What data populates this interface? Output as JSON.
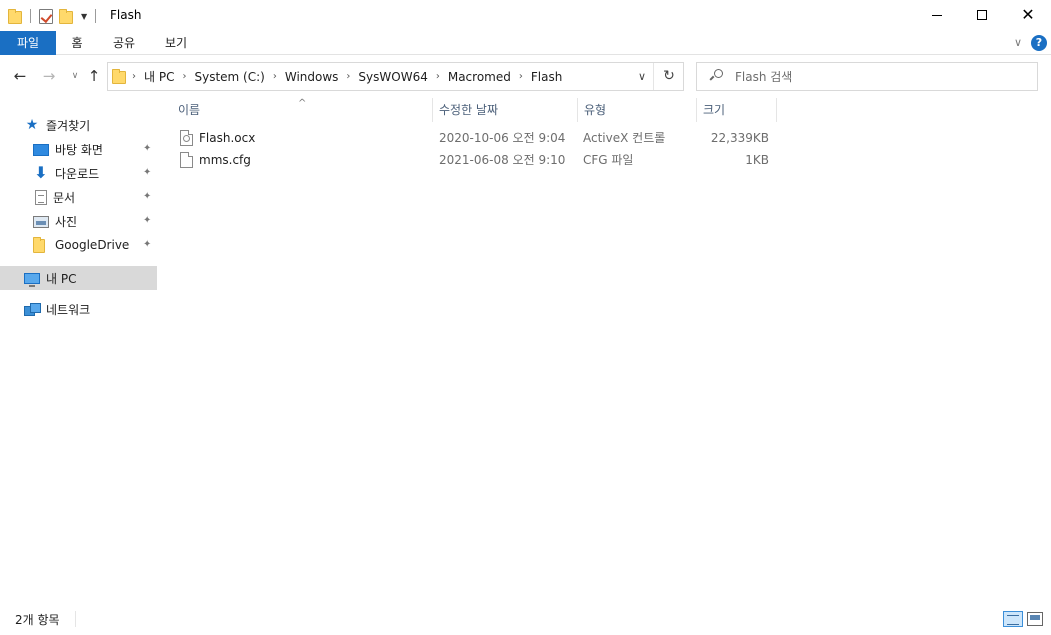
{
  "window": {
    "title": "Flash",
    "minimize_glyph": "",
    "close_glyph": "✕"
  },
  "ribbon": {
    "tabs": [
      {
        "label": "파일"
      },
      {
        "label": "홈"
      },
      {
        "label": "공유"
      },
      {
        "label": "보기"
      }
    ],
    "expand_glyph": "∨",
    "help_glyph": "?"
  },
  "nav": {
    "back_glyph": "←",
    "forward_glyph": "→",
    "recent_glyph": "∨",
    "up_glyph": "↑",
    "breadcrumb": [
      "내 PC",
      "System (C:)",
      "Windows",
      "SysWOW64",
      "Macromed",
      "Flash"
    ],
    "crumb_sep": "›",
    "dropdown_glyph": "∨",
    "refresh_glyph": "↻",
    "search_placeholder": "Flash 검색"
  },
  "sidebar": {
    "quick_access": {
      "label": "즐겨찾기",
      "icon": "star-icon"
    },
    "pinned": [
      {
        "label": "바탕 화면",
        "icon": "desktop-icon"
      },
      {
        "label": "다운로드",
        "icon": "download-icon"
      },
      {
        "label": "문서",
        "icon": "documents-icon"
      },
      {
        "label": "사진",
        "icon": "pictures-icon"
      },
      {
        "label": "GoogleDrive",
        "icon": "folder-icon"
      }
    ],
    "pin_glyph": "📌",
    "this_pc": {
      "label": "내 PC",
      "icon": "computer-icon"
    },
    "network": {
      "label": "네트워크",
      "icon": "network-icon"
    }
  },
  "columns": {
    "name": "이름",
    "modified": "수정한 날짜",
    "type": "유형",
    "size": "크기",
    "sort_glyph": "^"
  },
  "files": [
    {
      "name": "Flash.ocx",
      "modified": "2020-10-06 오전 9:04",
      "type": "ActiveX 컨트롤",
      "size": "22,339KB",
      "icon": "activex-file-icon"
    },
    {
      "name": "mms.cfg",
      "modified": "2021-06-08 오전 9:10",
      "type": "CFG 파일",
      "size": "1KB",
      "icon": "file-icon"
    }
  ],
  "status": {
    "item_count": "2개 항목"
  },
  "colors": {
    "accent": "#1a6fc3",
    "selected_bg": "#d9d9d9",
    "folder": "#ffd96b"
  }
}
